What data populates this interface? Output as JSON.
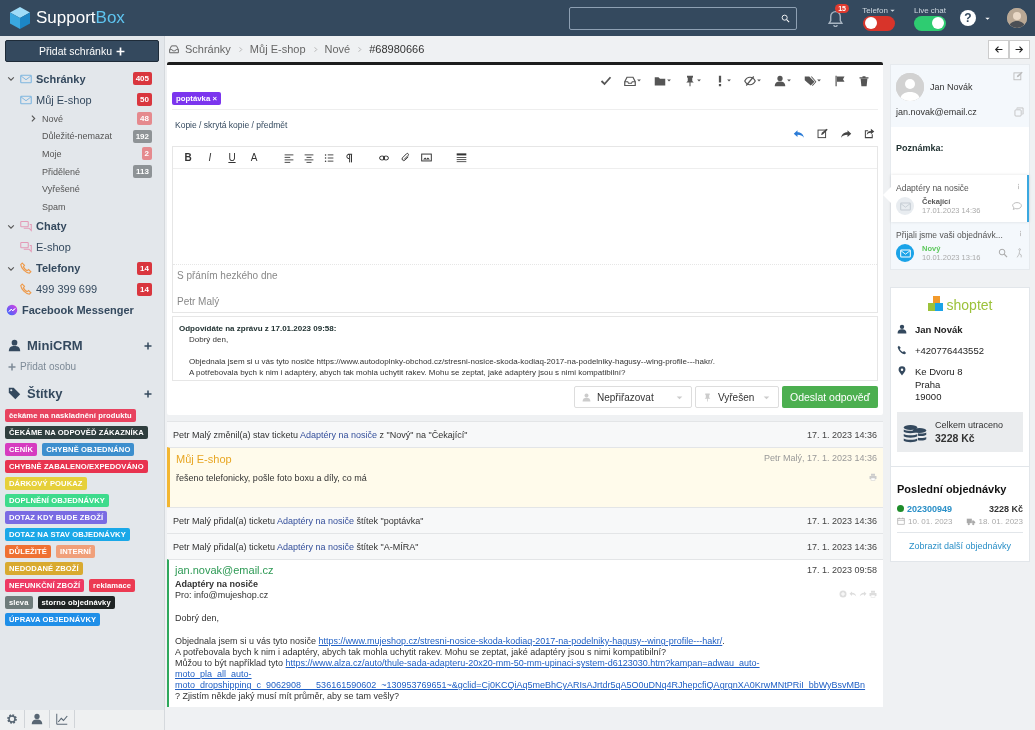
{
  "topbar": {
    "logo": [
      "Support",
      "Box"
    ],
    "notifications": "15",
    "toggles": [
      {
        "label": "Telefon",
        "on": false,
        "has_menu": true
      },
      {
        "label": "Live chat",
        "on": true,
        "has_menu": false
      }
    ],
    "help": "?"
  },
  "sidebar": {
    "add_button": "Přidat schránku",
    "tree": [
      {
        "label": "Schránky",
        "kind": "mail",
        "badge": "405",
        "color": "#d9363e",
        "expanded": true,
        "children": [
          {
            "label": "Můj E-shop",
            "kind": "mail",
            "badge": "50",
            "color": "#d9363e",
            "children": [
              {
                "label": "Nové",
                "badge": "48",
                "color": "#e58a8e",
                "expanded": false
              },
              {
                "label": "Důležité-nemazat",
                "badge": "192",
                "color": "#8e9396"
              },
              {
                "label": "Moje",
                "badge": "2",
                "color": "#e58a8e"
              },
              {
                "label": "Přidělené",
                "badge": "113",
                "color": "#8e9396"
              },
              {
                "label": "Vyřešené"
              },
              {
                "label": "Spam"
              }
            ]
          }
        ]
      },
      {
        "label": "Chaty",
        "kind": "chat",
        "expanded": true,
        "children": [
          {
            "label": "E-shop",
            "kind": "chat"
          }
        ]
      },
      {
        "label": "Telefony",
        "kind": "phone",
        "badge": "14",
        "color": "#d9363e",
        "expanded": true,
        "children": [
          {
            "label": "499 399 699",
            "kind": "phone",
            "badge": "14",
            "color": "#d9363e"
          }
        ]
      },
      {
        "label": "Facebook Messenger",
        "kind": "messenger"
      }
    ],
    "crm": {
      "title": "MiniCRM",
      "add": "Přidat osobu"
    },
    "tags": {
      "title": "Štítky",
      "items": [
        {
          "label": "čekáme na naskladnění produktu",
          "color": "#e8435f"
        },
        {
          "label": "ČEKÁME NA ODPOVĚĎ ZÁKAZNÍKA",
          "color": "#2f3e3e"
        },
        {
          "label": "CENÍK",
          "color": "#d63cc0"
        },
        {
          "label": "CHYBNĚ OBJEDNÁNO",
          "color": "#3d8fce"
        },
        {
          "label": "CHYBNĚ ZABALENO/EXPEDOVÁNO",
          "color": "#e8334f"
        },
        {
          "label": "DÁRKOVÝ POUKAZ",
          "color": "#e6d03a"
        },
        {
          "label": "DOPLNĚNÍ OBJEDNÁVKY",
          "color": "#3edb8c"
        },
        {
          "label": "DOTAZ KDY BUDE ZBOŽÍ",
          "color": "#7a6be3"
        },
        {
          "label": "DOTAZ NA STAV OBJEDNÁVKY",
          "color": "#1aa8e8"
        },
        {
          "label": "DŮLEŽITÉ",
          "color": "#ef7132"
        },
        {
          "label": "INTERNÍ",
          "color": "#f0a07a"
        },
        {
          "label": "NEDODANÉ ZBOŽÍ",
          "color": "#d9aa30"
        },
        {
          "label": "NEFUNKČNÍ ZBOŽÍ",
          "color": "#ee3a64"
        },
        {
          "label": "reklamace",
          "color": "#ec3a52"
        },
        {
          "label": "sleva",
          "color": "#6e7b7b"
        },
        {
          "label": "storno objednávky",
          "color": "#1f2424"
        },
        {
          "label": "ÚPRAVA OBJEDNÁVKY",
          "color": "#1f8fe8"
        }
      ]
    }
  },
  "breadcrumb": [
    "Schránky",
    "Můj E-shop",
    "Nové",
    "#68980666"
  ],
  "ticket_tag": "poptávka ×",
  "compose": {
    "fields_link": "Kopie / skrytá kopie / předmět",
    "format_buttons": [
      {
        "label": "B",
        "kind": "bold"
      },
      {
        "label": "I",
        "kind": "italic"
      },
      {
        "label": "U",
        "kind": "underline"
      },
      {
        "label": "A",
        "kind": "size"
      }
    ],
    "signature": [
      "S přáním hezkého dne",
      "Petr Malý"
    ],
    "quote": {
      "heading": "Odpovídáte na zprávu z 17.01.2023 09:58:",
      "lines": [
        "Dobrý den,",
        "Objednala jsem si u vás tyto nosiče https://www.autodoplnky-obchod.cz/stresni-nosice-skoda-kodiaq-2017-na-podelniky-hagusy--wing-profile---hakr/.",
        "A potřebovala bych k nim i adaptéry, abych tak mohla uchytit rakev. Mohu se zeptat, jaké adaptéry jsou s nimi kompatibilní?"
      ]
    },
    "assign": "Nepřiřazovat",
    "status": "Vyřešen",
    "send": "Odeslat odpověď"
  },
  "timeline": [
    {
      "kind": "event",
      "before": "Petr Malý změnil(a) stav ticketu ",
      "link": "Adaptéry na nosiče",
      "after": " z \"Nový\" na \"Čekající\"",
      "time": "17. 1. 2023 14:36"
    },
    {
      "kind": "note",
      "author": "Můj E-shop",
      "meta": "Petr Malý, 17. 1. 2023 14:36",
      "text": "řešeno telefonicky, pošle foto boxu a díly, co má"
    },
    {
      "kind": "event",
      "before": "Petr Malý přidal(a) ticketu ",
      "link": "Adaptéry na nosiče",
      "after": " štítek \"poptávka\"",
      "time": "17. 1. 2023 14:36"
    },
    {
      "kind": "event",
      "before": "Petr Malý přidal(a) ticketu ",
      "link": "Adaptéry na nosiče",
      "after": " štítek \"A-MÍRA\"",
      "time": "17. 1. 2023 14:36"
    },
    {
      "kind": "email",
      "from": "jan.novak@email.cz",
      "time": "17. 1. 2023 09:58",
      "subject": "Adaptéry na nosiče",
      "to": "Pro: info@mujeshop.cz",
      "body": [
        [
          [
            {
              "text": "Dobrý den,"
            }
          ]
        ],
        [
          [
            {
              "text": "Objednala jsem si u vás tyto nosiče "
            },
            {
              "link": "https://www.mujeshop.cz/stresni-nosice-skoda-kodiaq-2017-na-podelniky-hagusy--wing-profile---hakr/"
            },
            {
              "text": "."
            }
          ],
          [
            {
              "text": "A potřebovala bych k nim i adaptéry, abych tak mohla uchytit rakev. Mohu se zeptat, jaké adaptéry jsou s nimi kompatibilní?"
            }
          ],
          [
            {
              "text": "Můžou to být například tyto "
            },
            {
              "link": "https://www.alza.cz/auto/thule-sada-adapteru-20x20-mm-50-mm-upinaci-system-d6123030.htm?kampan=adwau_auto-"
            }
          ],
          [
            {
              "link": "moto_pla_all_auto-"
            }
          ],
          [
            {
              "link": "moto_dropshipping_c_9062908___536161590602_~130953769651~&gclid=Cj0KCQiAq5meBhCyARIsAJrtdr5qA5O0uDNq4RJhepcfiQAgrgnXA0KrwMNtPRiI_bbWyBsvMBn"
            }
          ],
          [
            {
              "text": "? Zjistím někde jaký musí mít průměr, aby se tam vešly?"
            }
          ]
        ]
      ]
    }
  ],
  "contact": {
    "name": "Jan Novák",
    "email": "jan.novak@email.cz",
    "note_label": "Poznámka:",
    "tickets": [
      {
        "title": "Adaptéry na nosiče",
        "status": "Čekající",
        "color": "#555555",
        "date": "17.01.2023 14:36",
        "selected": true
      },
      {
        "title": "Přijali jsme vaši objednávk...",
        "status": "Nový",
        "color": "#5cc85c",
        "date": "10.01.2023 13:16",
        "selected": false
      }
    ]
  },
  "shop": {
    "logo": "shoptet",
    "name": "Jan Novák",
    "phone": "+420776443552",
    "address": [
      "Ke Dvoru 8",
      "Praha",
      "19000"
    ],
    "spent_label": "Celkem utraceno",
    "spent": "3228 Kč",
    "orders_title": "Poslední objednávky",
    "orders": [
      {
        "number": "202300949",
        "amount": "3228 Kč",
        "created": "10. 01. 2023",
        "shipped": "18. 01. 2023",
        "color": "#1e8c2a"
      }
    ],
    "more": "Zobrazit další objednávky"
  }
}
